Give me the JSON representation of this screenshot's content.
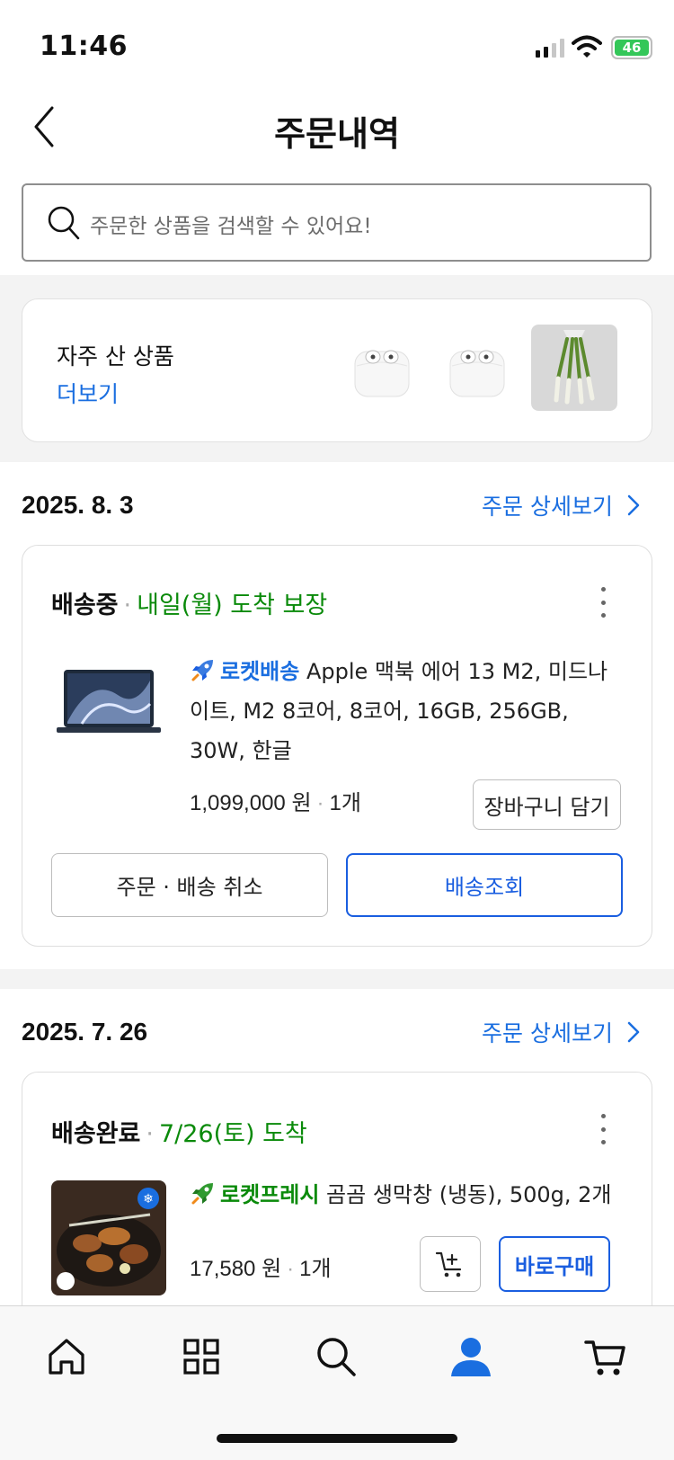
{
  "status_bar": {
    "time": "11:46",
    "battery": "46"
  },
  "header": {
    "title": "주문내역"
  },
  "search": {
    "placeholder": "주문한 상품을 검색할 수 있어요!"
  },
  "frequent": {
    "title": "자주 산 상품",
    "more_label": "더보기",
    "items": [
      "airpods",
      "airpods",
      "green-onion"
    ]
  },
  "orders": [
    {
      "date": "2025. 8. 3",
      "detail_label": "주문 상세보기",
      "status": "배송중",
      "status_detail": "내일(월) 도착 보장",
      "delivery_tag": "로켓배송",
      "product_name": "Apple 맥북 에어 13 M2, 미드나이트, M2 8코어, 8코어, 16GB, 256GB, 30W, 한글",
      "price": "1,099,000 원",
      "quantity": "1개",
      "cart_button": "장바구니 담기",
      "cancel_button": "주문 · 배송 취소",
      "track_button": "배송조회"
    },
    {
      "date": "2025. 7. 26",
      "detail_label": "주문 상세보기",
      "status": "배송완료",
      "status_detail": "7/26(토) 도착",
      "delivery_tag": "로켓프레시",
      "product_name": "곰곰 생막창 (냉동), 500g, 2개",
      "price": "17,580 원",
      "quantity": "1개",
      "buy_button": "바로구매"
    }
  ],
  "tabs": [
    "home",
    "categories",
    "search",
    "my",
    "cart"
  ],
  "colors": {
    "accent": "#1a6ee0",
    "green": "#0a8a0a",
    "active_tab": "#1a6ee0"
  }
}
